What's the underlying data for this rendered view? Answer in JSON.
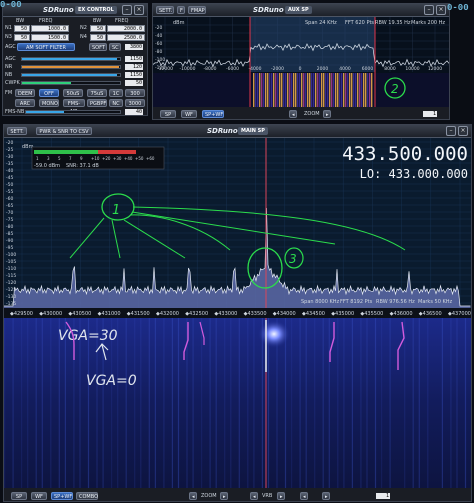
{
  "clock_left": "0-00",
  "clock_right": "0-00",
  "ex": {
    "logo": "SDRuno",
    "title": "EX CONTROL",
    "col_bw": "BW",
    "col_freq": "FREQ",
    "rows": [
      {
        "n": "N1",
        "bw": "50",
        "freq": "1000.0",
        "n2": "N2",
        "bw2": "50",
        "freq2": "2000.0"
      },
      {
        "n": "N3",
        "bw": "50",
        "freq": "1500.0",
        "n2": "N4",
        "bw2": "50",
        "freq2": "2500.0"
      }
    ],
    "agc_label": "AGC",
    "agc_value": "AM SOFT FILTER",
    "soft_btn": "SOFT",
    "sc_btn": "SC",
    "soft_value": "3800",
    "nr_label": "NR",
    "nb_label": "NB",
    "cwpk_label": "CWPK",
    "fm_label": "FM",
    "sliders": [
      {
        "label": "AGC",
        "value": "1150",
        "color": "#3aa6e8"
      },
      {
        "label": "NR",
        "value": "120",
        "color": "#e0913a"
      },
      {
        "label": "NB",
        "value": "1150",
        "color": "#3aa6e8"
      },
      {
        "label": "CWPK",
        "value": "50",
        "color": "#2fcf7a"
      }
    ],
    "fm_buttons": [
      "DEEM",
      "OFF",
      "50uS",
      "75uS",
      "1C",
      "300"
    ],
    "am_buttons": [
      "ARC",
      "MONO",
      "FMS-NR",
      "PGBPF",
      "NC",
      "3000"
    ],
    "fms_nb_label": "FMS-NB",
    "fms_nb_value": "40"
  },
  "aux": {
    "logo": "SDRuno",
    "title": "AUX SP",
    "sett_btn": "SETT.",
    "f_btn": "F",
    "fmap_btn": "FMAP",
    "span": "Span 24 KHz",
    "fft": "FFT 620 Pts",
    "rbw": "RBW 19.35 Hz",
    "marks": "Marks 200 Hz",
    "dbm": "dBm",
    "yticks": [
      "-20",
      "-40",
      "-60",
      "-80",
      "-100",
      "-120"
    ],
    "xticks": [
      "-12000",
      "-10000",
      "-8000",
      "-6000",
      "-4000",
      "-2000",
      "0",
      "2000",
      "4000",
      "6000",
      "8000",
      "10000",
      "12000"
    ],
    "sp_btn": "SP",
    "wf_btn": "WF",
    "spwf_btn": "SP+WF",
    "zoom_label": "ZOOM",
    "zoom_value": "1"
  },
  "main": {
    "logo": "SDRuno",
    "title": "MAIN SP",
    "sett_btn": "SETT.",
    "csv_btn": "PWR & SNR TO CSV",
    "dbm": "dBm",
    "smeter_scale": [
      "1",
      "3",
      "5",
      "7",
      "9",
      "+10",
      "+20",
      "+30",
      "+40",
      "+50",
      "+60"
    ],
    "level": "-59.0 dBm",
    "snr": "SNR: 37.1 dB",
    "frequency": "433.500.000",
    "lo": "LO: 433.000.000",
    "yticks": [
      "-20",
      "-25",
      "-30",
      "-35",
      "-40",
      "-45",
      "-50",
      "-55",
      "-60",
      "-65",
      "-70",
      "-75",
      "-80",
      "-85",
      "-90",
      "-95",
      "-100",
      "-105",
      "-110",
      "-115",
      "-120",
      "-125",
      "-130",
      "-135"
    ],
    "span": "Span 8000 KHz",
    "fft": "FFT 8192 Pts",
    "rbw": "RBW 976.56 Hz",
    "marks": "Marks 50 KHz",
    "xticks": [
      "429500",
      "430000",
      "430500",
      "431000",
      "431500",
      "432000",
      "432500",
      "433000",
      "433500",
      "434000",
      "434500",
      "435000",
      "435500",
      "436000",
      "436500",
      "437000"
    ],
    "sp_btn": "SP",
    "wf_btn": "WF",
    "spwf_btn": "SP+WF",
    "combo_btn": "COMBO",
    "zoom_label": "ZOOM",
    "vrb_label": "VRB",
    "zoom_value": "1"
  },
  "annotations": {
    "one": "1",
    "two": "2",
    "three": "3",
    "vga30": "VGA=30",
    "vga0": "VGA=0"
  }
}
